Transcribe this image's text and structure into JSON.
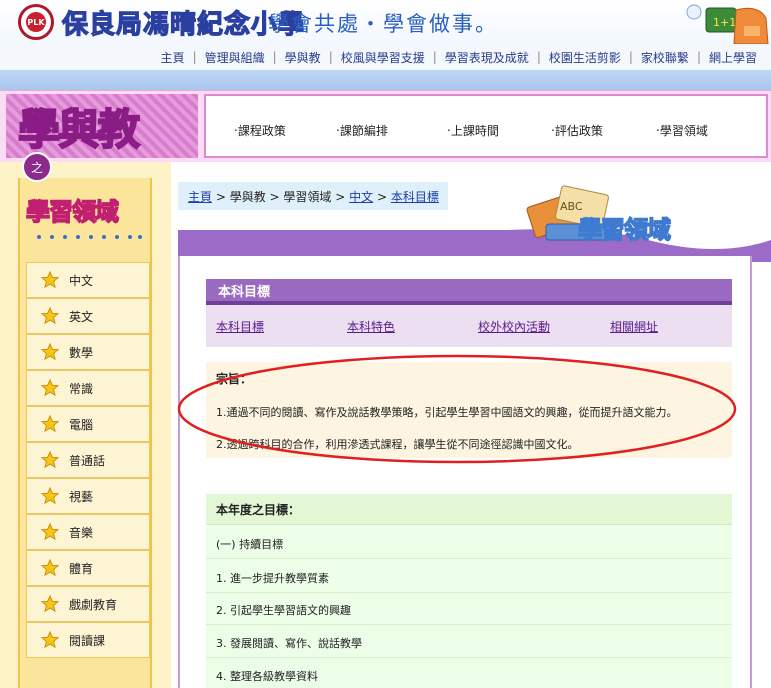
{
  "header": {
    "school_name": "保良局馮晴紀念小學",
    "motto": "學會共處・學會做事。"
  },
  "nav": {
    "items": [
      "主頁",
      "管理與組織",
      "學與教",
      "校風與學習支援",
      "學習表現及成就",
      "校園生活剪影",
      "家校聯繫",
      "網上學習"
    ]
  },
  "page_banner": {
    "title": "學與教",
    "connector": "之",
    "subnav": [
      "‧課程政策",
      "‧課節編排",
      "‧上課時間",
      "‧評估政策",
      "‧學習領域"
    ]
  },
  "sidebar": {
    "title": "學習領域",
    "items": [
      "中文",
      "英文",
      "數學",
      "常識",
      "電腦",
      "普通話",
      "視藝",
      "音樂",
      "體育",
      "戲劇教育",
      "閱讀課"
    ]
  },
  "breadcrumb": {
    "home": "主頁",
    "sep": " > ",
    "teaching": "學與教",
    "areas": "學習領域",
    "chinese": "中文",
    "current": "本科目標"
  },
  "content_banner": {
    "title": "學習領域",
    "books_text": "ABC"
  },
  "section": {
    "title": "本科目標",
    "tabs": [
      "本科目標",
      "本科特色",
      "校外校內活動",
      "相關網址"
    ]
  },
  "aims": {
    "title": "宗旨：",
    "lines": [
      "1.通過不同的閱讀、寫作及說話教學策略，引起學生學習中國語文的興趣，從而提升語文能力。",
      "2.透過跨科目的合作，利用滲透式課程，讓學生從不同途徑認識中國文化。"
    ]
  },
  "goals": {
    "title": "本年度之目標：",
    "lines": [
      "(一) 持續目標",
      "1. 進一步提升教學質素",
      "2. 引起學生學習語文的興趣",
      "3. 發展閱讀、寫作、說話教學",
      "4. 整理各級教學資料"
    ]
  },
  "colors": {
    "nav_text": "#2a3c8c",
    "section_purple": "#9a6ac0",
    "highlight_oval": "#e02020",
    "sidebar_bg": "#fbe59a"
  }
}
